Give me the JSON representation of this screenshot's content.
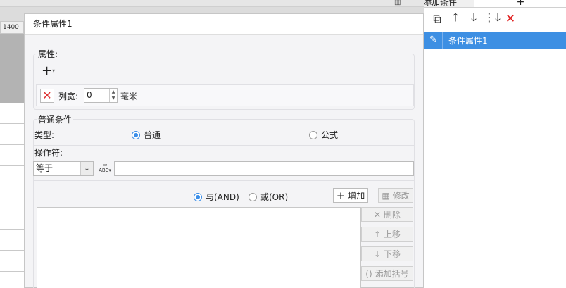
{
  "background": {
    "ruler_value": "1400"
  },
  "dialog": {
    "title": "条件属性1",
    "attribute": {
      "group_label": "属性:",
      "add_symbol": "+",
      "delete_symbol": "✕",
      "width_label": "列宽:",
      "width_value": "0",
      "width_unit": "毫米"
    },
    "condition": {
      "group_label": "普通条件",
      "type_label": "类型:",
      "type_options": [
        {
          "label": "普通",
          "selected": true
        },
        {
          "label": "公式",
          "selected": false
        }
      ],
      "operator_label": "操作符:",
      "operator_value": "等于",
      "value": "",
      "logic_options": [
        {
          "label": "与(AND)",
          "selected": true
        },
        {
          "label": "或(OR)",
          "selected": false
        }
      ],
      "add_button": "增加",
      "edit_button": "修改",
      "delete_button": "删除",
      "up_button": "上移",
      "down_button": "下移",
      "bracket_button": "添加括号"
    }
  },
  "right_panel": {
    "tab_label": "添加条件",
    "tab_add": "+",
    "toolbar": [
      "copy-icon",
      "arrow-up-icon",
      "arrow-down-icon",
      "move-bottom-icon",
      "close-icon"
    ],
    "items": [
      {
        "label": "条件属性1",
        "selected": true
      }
    ]
  },
  "colors": {
    "accent": "#3d8fe3",
    "danger": "#e02020"
  }
}
